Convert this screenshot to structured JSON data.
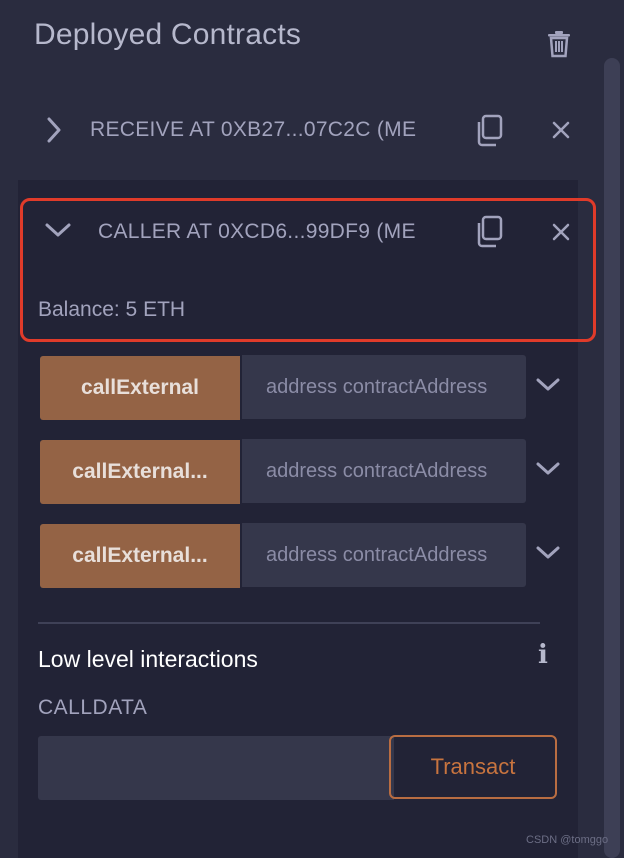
{
  "header": {
    "title": "Deployed Contracts",
    "trash_icon": "trash-icon"
  },
  "contracts": [
    {
      "label": "RECEIVE AT 0XB27...07C2C (ME",
      "state": "collapsed",
      "icons": [
        "chevron-right-icon",
        "copy-icon",
        "close-icon"
      ]
    },
    {
      "label": "CALLER AT 0XCD6...99DF9 (ME",
      "state": "expanded",
      "icons": [
        "chevron-down-icon",
        "copy-icon",
        "close-icon"
      ]
    }
  ],
  "selected": {
    "balance": "Balance: 5 ETH",
    "highlight_color": "#e03b2a"
  },
  "functions": [
    {
      "label": "callExternal",
      "placeholder": "address contractAddress"
    },
    {
      "label": "callExternal...",
      "placeholder": "address contractAddress"
    },
    {
      "label": "callExternal...",
      "placeholder": "address contractAddress"
    }
  ],
  "low_level": {
    "title": "Low level interactions",
    "info_icon": "i",
    "calldata_label": "CALLDATA",
    "calldata_value": "",
    "transact_label": "Transact"
  },
  "watermark": "CSDN @tomggo",
  "colors": {
    "background": "#2a2c3f",
    "panel": "#222336",
    "function_button": "#946345",
    "accent": "#c8743f"
  }
}
